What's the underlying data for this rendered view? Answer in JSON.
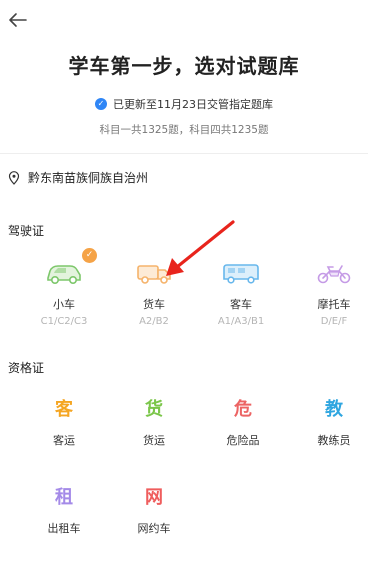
{
  "header": {
    "title": "学车第一步，选对试题库"
  },
  "update": {
    "check_glyph": "✓",
    "text": "已更新至11月23日交管指定题库",
    "counts": "科目一共1325题，科目四共1235题"
  },
  "location": {
    "text": "黔东南苗族侗族自治州"
  },
  "license_section": {
    "title": "驾驶证",
    "items": [
      {
        "name": "小车",
        "sub": "C1/C2/C3",
        "icon": "car-icon",
        "color": "#7dc76b",
        "badge": "✓"
      },
      {
        "name": "货车",
        "sub": "A2/B2",
        "icon": "truck-icon",
        "color": "#f5b36b"
      },
      {
        "name": "客车",
        "sub": "A1/A3/B1",
        "icon": "bus-icon",
        "color": "#67b7ec"
      },
      {
        "name": "摩托车",
        "sub": "D/E/F",
        "icon": "motorcycle-icon",
        "color": "#c59be6"
      }
    ]
  },
  "qualification_section": {
    "title": "资格证",
    "items": [
      {
        "char": "客",
        "name": "客运",
        "color": "#f5a623"
      },
      {
        "char": "货",
        "name": "货运",
        "color": "#7bc64a"
      },
      {
        "char": "危",
        "name": "危险品",
        "color": "#ec6464"
      },
      {
        "char": "教",
        "name": "教练员",
        "color": "#2fa6e0"
      },
      {
        "char": "租",
        "name": "出租车",
        "color": "#a48ae8"
      },
      {
        "char": "网",
        "name": "网约车",
        "color": "#ef5d5d"
      }
    ]
  },
  "annotation": {
    "arrow_color": "#e8241c"
  }
}
